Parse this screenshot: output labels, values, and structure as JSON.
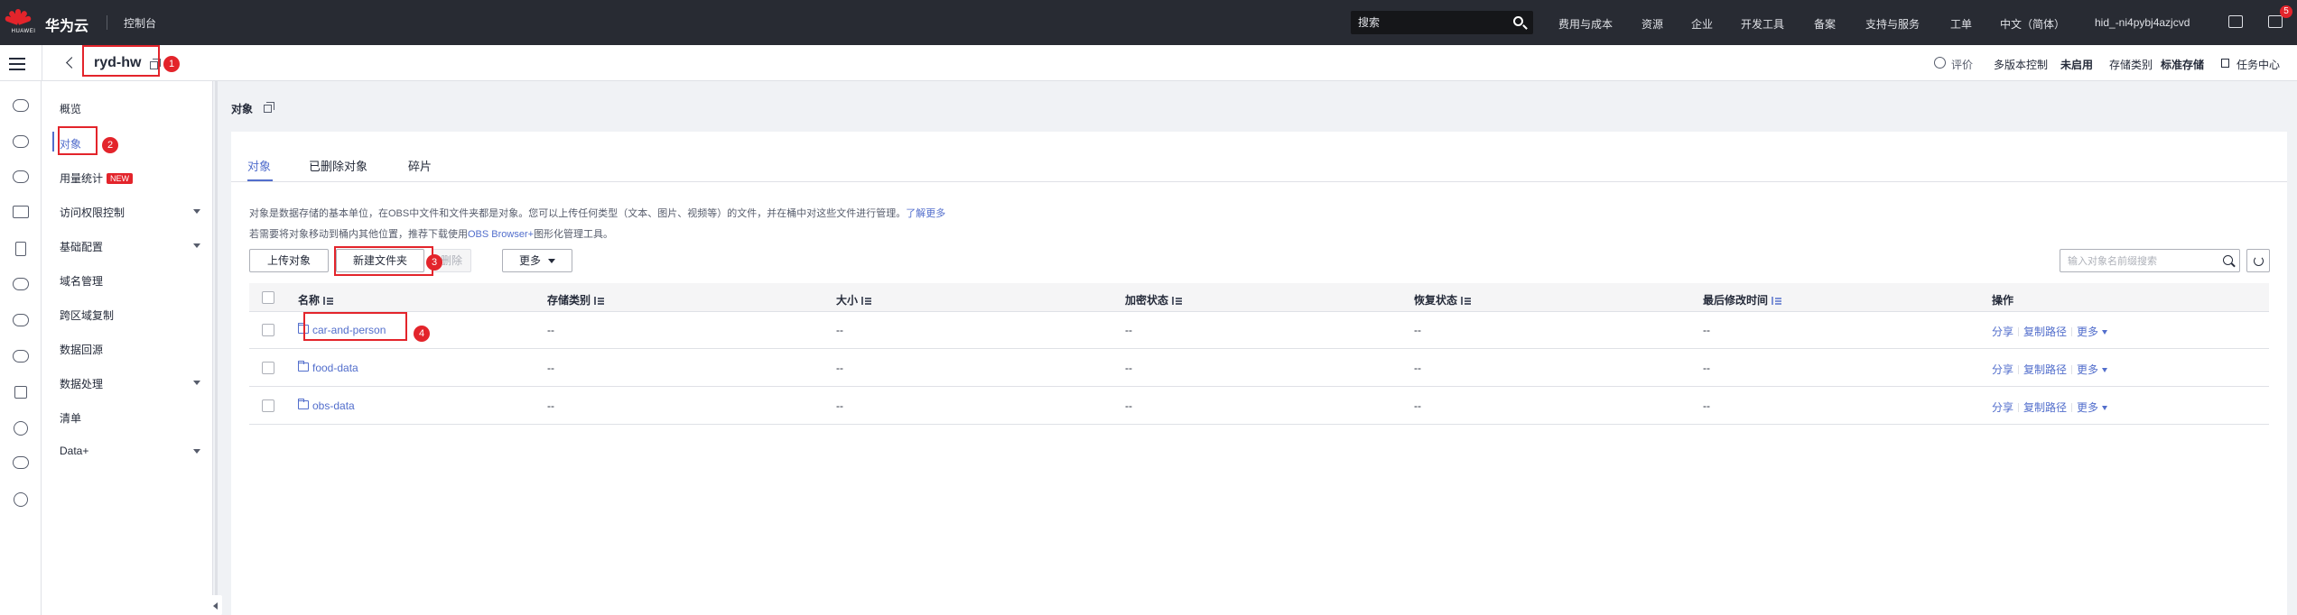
{
  "topbar": {
    "logo_caption": "HUAWEI",
    "brand": "华为云",
    "console": "控制台",
    "search_placeholder": "搜索",
    "nav": [
      "费用与成本",
      "资源",
      "企业",
      "开发工具",
      "备案",
      "支持与服务",
      "工单",
      "中文（简体）",
      "hid_-ni4pybj4azjcvd"
    ],
    "notification_count": "5"
  },
  "subbar": {
    "bucket_name": "ryd-hw",
    "rate": "评价",
    "versioning_label": "多版本控制",
    "versioning_value": "未启用",
    "storage_class_label": "存储类别",
    "storage_class_value": "标准存储",
    "task_center": "任务中心"
  },
  "annotations": [
    "1",
    "2",
    "3",
    "4"
  ],
  "sidebar": {
    "items": [
      {
        "label": "概览",
        "expandable": false
      },
      {
        "label": "对象",
        "expandable": false,
        "active": true
      },
      {
        "label": "用量统计",
        "expandable": false,
        "badge": "NEW"
      },
      {
        "label": "访问权限控制",
        "expandable": true
      },
      {
        "label": "基础配置",
        "expandable": true
      },
      {
        "label": "域名管理",
        "expandable": false
      },
      {
        "label": "跨区域复制",
        "expandable": false
      },
      {
        "label": "数据回源",
        "expandable": false
      },
      {
        "label": "数据处理",
        "expandable": true
      },
      {
        "label": "清单",
        "expandable": false
      },
      {
        "label": "Data+",
        "expandable": true
      }
    ]
  },
  "page": {
    "title": "对象",
    "tabs": [
      "对象",
      "已删除对象",
      "碎片"
    ],
    "desc1_text": "对象是数据存储的基本单位，在OBS中文件和文件夹都是对象。您可以上传任何类型（文本、图片、视频等）的文件，并在桶中对这些文件进行管理。",
    "desc1_link": "了解更多",
    "desc2_prefix": "若需要将对象移动到桶内其他位置，推荐下载使用",
    "desc2_link": "OBS Browser+",
    "desc2_suffix": "图形化管理工具。",
    "buttons": {
      "upload": "上传对象",
      "new_folder": "新建文件夹",
      "delete": "删除",
      "more": "更多"
    },
    "filter_placeholder": "输入对象名前缀搜索"
  },
  "table": {
    "columns": [
      "名称",
      "存储类别",
      "大小",
      "加密状态",
      "恢复状态",
      "最后修改时间",
      "操作"
    ],
    "rows": [
      {
        "name": "car-and-person",
        "storage_class": "--",
        "size": "--",
        "encryption": "--",
        "restore": "--",
        "modified": "--"
      },
      {
        "name": "food-data",
        "storage_class": "--",
        "size": "--",
        "encryption": "--",
        "restore": "--",
        "modified": "--"
      },
      {
        "name": "obs-data",
        "storage_class": "--",
        "size": "--",
        "encryption": "--",
        "restore": "--",
        "modified": "--"
      }
    ],
    "ops": {
      "share": "分享",
      "copy_path": "复制路径",
      "more": "更多"
    }
  },
  "colors": {
    "accent": "#526ecc",
    "topbar": "#282b33",
    "annotation": "#e3242b"
  }
}
